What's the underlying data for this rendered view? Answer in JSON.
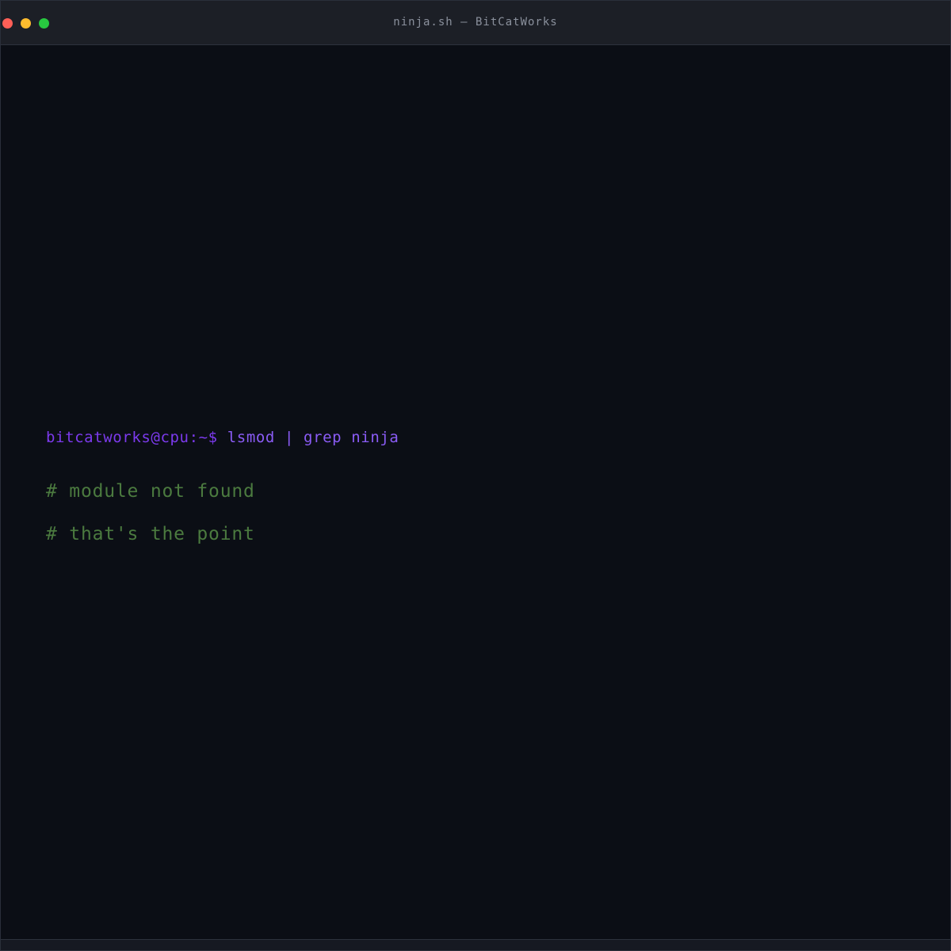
{
  "window": {
    "title": "ninja.sh — BitCatWorks",
    "controls": {
      "close_color": "#ff5f57",
      "minimize_color": "#febc2e",
      "zoom_color": "#28c840"
    }
  },
  "terminal": {
    "prompt": "bitcatworks@cpu:~$",
    "command": "lsmod | grep ninja",
    "output": [
      "# module not found",
      "# that's the point"
    ],
    "colors": {
      "prompt": "#7c3aed",
      "command": "#8b5cf6",
      "comment": "#4b7a3f",
      "background": "#0b0e15"
    }
  }
}
